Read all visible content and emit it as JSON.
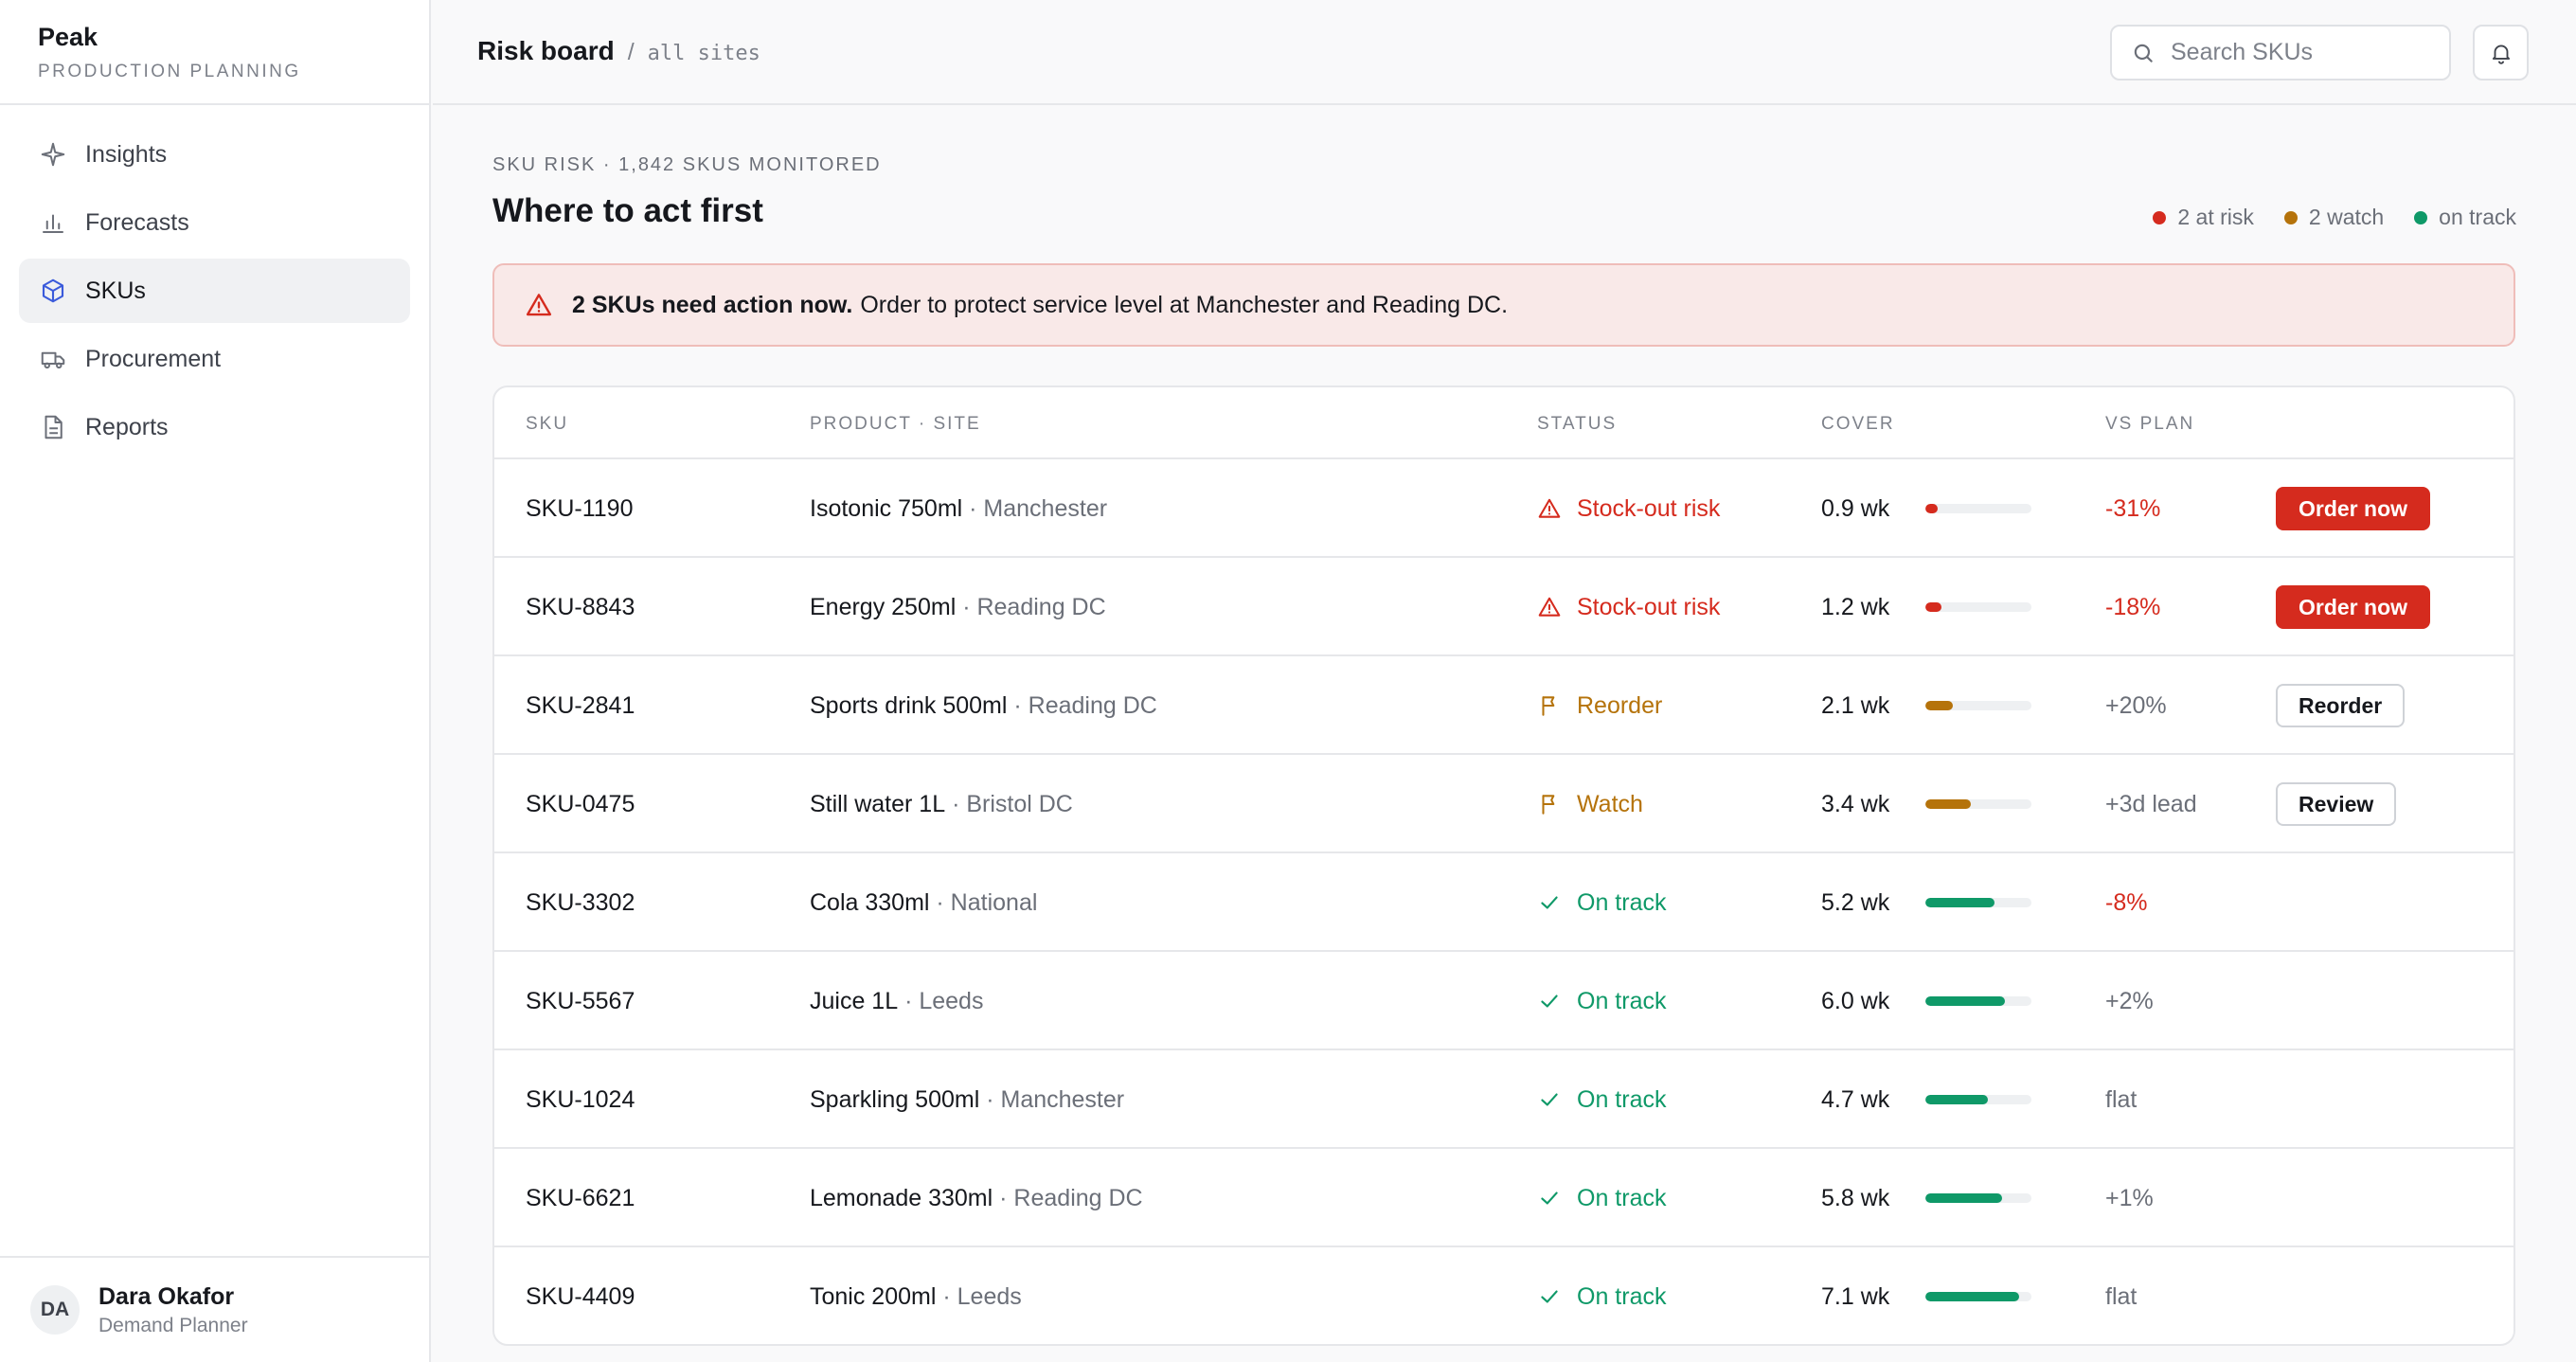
{
  "brand": {
    "name": "Peak",
    "subtitle": "PRODUCTION PLANNING"
  },
  "sidebar": {
    "items": [
      {
        "label": "Insights",
        "icon": "sparkle-icon",
        "active": false
      },
      {
        "label": "Forecasts",
        "icon": "bar-chart-icon",
        "active": false
      },
      {
        "label": "SKUs",
        "icon": "box-icon",
        "active": true
      },
      {
        "label": "Procurement",
        "icon": "truck-icon",
        "active": false
      },
      {
        "label": "Reports",
        "icon": "document-icon",
        "active": false
      }
    ]
  },
  "user": {
    "initials": "DA",
    "name": "Dara Okafor",
    "role": "Demand Planner"
  },
  "header": {
    "title": "Risk board",
    "separator": "/",
    "scope": "all sites",
    "search_placeholder": "Search SKUs"
  },
  "main": {
    "eyebrow": "SKU RISK · 1,842 SKUS MONITORED",
    "heading": "Where to act first",
    "legend": [
      {
        "label": "2 at risk",
        "color": "#d52b1e"
      },
      {
        "label": "2 watch",
        "color": "#b5730b"
      },
      {
        "label": "on track",
        "color": "#0f9968"
      }
    ],
    "alert": {
      "bold": "2 SKUs need action now.",
      "text": "Order to protect service level at Manchester and Reading DC."
    }
  },
  "colors": {
    "risk": "#d52b1e",
    "watch": "#b5730b",
    "ok": "#0f9968"
  },
  "table": {
    "columns": [
      "SKU",
      "PRODUCT · SITE",
      "STATUS",
      "COVER",
      "VS PLAN"
    ],
    "rows": [
      {
        "sku": "SKU-1190",
        "product": "Isotonic 750ml",
        "site": "· Manchester",
        "status": "Stock-out risk",
        "level": "risk",
        "cover": "0.9 wk",
        "cover_weeks": 0.9,
        "vs_plan": "-31%",
        "plan_tone": "neg",
        "action": "Order now",
        "action_kind": "primary"
      },
      {
        "sku": "SKU-8843",
        "product": "Energy 250ml",
        "site": "· Reading DC",
        "status": "Stock-out risk",
        "level": "risk",
        "cover": "1.2 wk",
        "cover_weeks": 1.2,
        "vs_plan": "-18%",
        "plan_tone": "neg",
        "action": "Order now",
        "action_kind": "primary"
      },
      {
        "sku": "SKU-2841",
        "product": "Sports drink 500ml",
        "site": "· Reading DC",
        "status": "Reorder",
        "level": "watch",
        "cover": "2.1 wk",
        "cover_weeks": 2.1,
        "vs_plan": "+20%",
        "plan_tone": "neutral",
        "action": "Reorder",
        "action_kind": "secondary"
      },
      {
        "sku": "SKU-0475",
        "product": "Still water 1L",
        "site": "· Bristol DC",
        "status": "Watch",
        "level": "watch",
        "cover": "3.4 wk",
        "cover_weeks": 3.4,
        "vs_plan": "+3d lead",
        "plan_tone": "neutral",
        "action": "Review",
        "action_kind": "secondary"
      },
      {
        "sku": "SKU-3302",
        "product": "Cola 330ml",
        "site": "· National",
        "status": "On track",
        "level": "ok",
        "cover": "5.2 wk",
        "cover_weeks": 5.2,
        "vs_plan": "-8%",
        "plan_tone": "neg",
        "action": "",
        "action_kind": ""
      },
      {
        "sku": "SKU-5567",
        "product": "Juice 1L",
        "site": "· Leeds",
        "status": "On track",
        "level": "ok",
        "cover": "6.0 wk",
        "cover_weeks": 6.0,
        "vs_plan": "+2%",
        "plan_tone": "neutral",
        "action": "",
        "action_kind": ""
      },
      {
        "sku": "SKU-1024",
        "product": "Sparkling 500ml",
        "site": "· Manchester",
        "status": "On track",
        "level": "ok",
        "cover": "4.7 wk",
        "cover_weeks": 4.7,
        "vs_plan": "flat",
        "plan_tone": "neutral",
        "action": "",
        "action_kind": ""
      },
      {
        "sku": "SKU-6621",
        "product": "Lemonade 330ml",
        "site": "· Reading DC",
        "status": "On track",
        "level": "ok",
        "cover": "5.8 wk",
        "cover_weeks": 5.8,
        "vs_plan": "+1%",
        "plan_tone": "neutral",
        "action": "",
        "action_kind": ""
      },
      {
        "sku": "SKU-4409",
        "product": "Tonic 200ml",
        "site": "· Leeds",
        "status": "On track",
        "level": "ok",
        "cover": "7.1 wk",
        "cover_weeks": 7.1,
        "vs_plan": "flat",
        "plan_tone": "neutral",
        "action": "",
        "action_kind": ""
      }
    ]
  }
}
